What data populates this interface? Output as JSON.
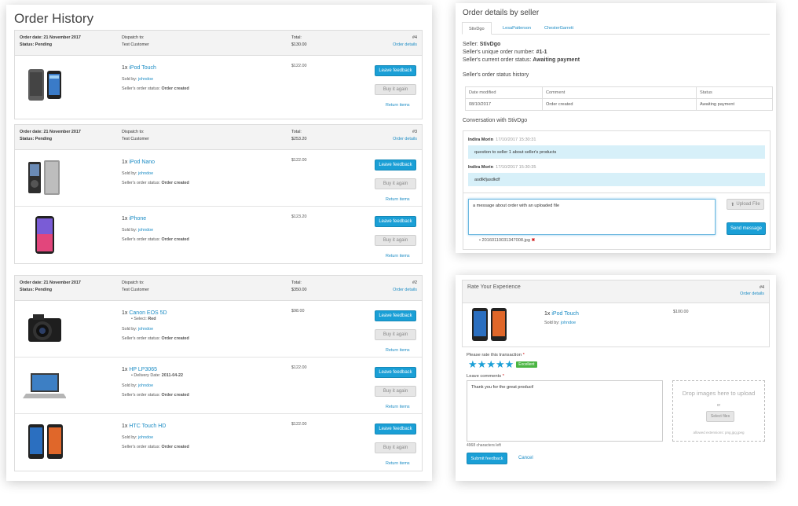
{
  "order_history": {
    "title": "Order History",
    "orders": [
      {
        "date": "Order date: 21 November 2017",
        "status": "Status: Pending",
        "dispatch_label": "Dispatch to:",
        "dispatch_to": "Test Customer",
        "total_label": "Total:",
        "total": "$130.00",
        "number": "#4",
        "details": "Order details",
        "items": [
          {
            "qty": "1x",
            "name": "iPod Touch",
            "sold_by_label": "Sold by:",
            "seller": "johndoe",
            "status_label": "Seller's order status:",
            "status": "Order created",
            "price": "$122.00",
            "extra_label": "",
            "extra_value": "",
            "feedback": "Leave feedback",
            "buy_again": "Buy it again",
            "return": "Return items"
          }
        ]
      },
      {
        "date": "Order date: 21 November 2017",
        "status": "Status: Pending",
        "dispatch_label": "Dispatch to:",
        "dispatch_to": "Test Customer",
        "total_label": "Total:",
        "total": "$253.20",
        "number": "#3",
        "details": "Order details",
        "items": [
          {
            "qty": "1x",
            "name": "iPod Nano",
            "sold_by_label": "Sold by:",
            "seller": "johndoe",
            "status_label": "Seller's order status:",
            "status": "Order created",
            "price": "$122.00",
            "extra_label": "",
            "extra_value": "",
            "feedback": "Leave feedback",
            "buy_again": "Buy it again",
            "return": "Return items"
          },
          {
            "qty": "1x",
            "name": "iPhone",
            "sold_by_label": "Sold by:",
            "seller": "johndoe",
            "status_label": "Seller's order status:",
            "status": "Order created",
            "price": "$123.20",
            "extra_label": "",
            "extra_value": "",
            "feedback": "Leave feedback",
            "buy_again": "Buy it again",
            "return": "Return items"
          }
        ]
      },
      {
        "date": "Order date: 21 November 2017",
        "status": "Status: Pending",
        "dispatch_label": "Dispatch to:",
        "dispatch_to": "Test Customer",
        "total_label": "Total:",
        "total": "$350.00",
        "number": "#2",
        "details": "Order details",
        "items": [
          {
            "qty": "1x",
            "name": "Canon EOS 5D",
            "sold_by_label": "Sold by:",
            "seller": "johndoe",
            "status_label": "Seller's order status:",
            "status": "Order created",
            "price": "$98.00",
            "extra_label": "Select:",
            "extra_value": "Red",
            "feedback": "Leave feedback",
            "buy_again": "Buy it again",
            "return": "Return items"
          },
          {
            "qty": "1x",
            "name": "HP LP3065",
            "sold_by_label": "Sold by:",
            "seller": "johndoe",
            "status_label": "Seller's order status:",
            "status": "Order created",
            "price": "$122.00",
            "extra_label": "Delivery Date:",
            "extra_value": "2011-04-22",
            "feedback": "Leave feedback",
            "buy_again": "Buy it again",
            "return": "Return items"
          },
          {
            "qty": "1x",
            "name": "HTC Touch HD",
            "sold_by_label": "Sold by:",
            "seller": "johndoe",
            "status_label": "Seller's order status:",
            "status": "Order created",
            "price": "$122.00",
            "extra_label": "",
            "extra_value": "",
            "feedback": "Leave feedback",
            "buy_again": "Buy it again",
            "return": "Return items"
          }
        ]
      }
    ]
  },
  "details": {
    "title": "Order details by seller",
    "tabs": [
      "StivDgo",
      "LesaPatterson",
      "ChesterGarrett"
    ],
    "seller_label": "Seller:",
    "seller": "StivDgo",
    "unique_label": "Seller's unique order number:",
    "unique": "#1-1",
    "current_label": "Seller's current order status:",
    "current": "Awaiting payment",
    "history_title": "Seller's order status history",
    "history_headers": [
      "Date modified",
      "Comment",
      "Status"
    ],
    "history_rows": [
      [
        "08/10/2017",
        "Order created",
        "Awaiting payment"
      ]
    ],
    "conversation_title": "Conversation with StivDgo",
    "messages": [
      {
        "author": "Indira Morin",
        "time": "17/10/2017 15:30:31",
        "text": "question to seller 1 about seller's products"
      },
      {
        "author": "Indira Morin",
        "time": "17/10/2017 15:30:35",
        "text": "asdlkfjasdkdf"
      }
    ],
    "message_value": "a message about order with an uploaded file",
    "upload_label": "Upload File",
    "send_label": "Send message",
    "attached_file": "20160110031347008.jpg"
  },
  "rate": {
    "title": "Rate Your Experience",
    "number": "#4",
    "details": "Order details",
    "qty": "1x",
    "name": "iPod Touch",
    "sold_by_label": "Sold by:",
    "seller": "johndoe",
    "price": "$100.00",
    "rate_label": "Please rate this transaction",
    "stars": 5,
    "rating_badge": "Excellent",
    "comments_label": "Leave comments",
    "comment_value": "Thank you for the great product!",
    "chars_left": "4968 characters left",
    "drop_title": "Drop images here to upload",
    "drop_or": "or",
    "select_files": "Select files",
    "allowed": "allowed extensions: png,jpg,jpeg",
    "submit": "Submit feedback",
    "cancel": "Cancel"
  },
  "colors": {
    "accent": "#1a9fd6",
    "link": "#1a8bc4",
    "message_bg": "#d7f0f9",
    "badge": "#4bb543"
  }
}
